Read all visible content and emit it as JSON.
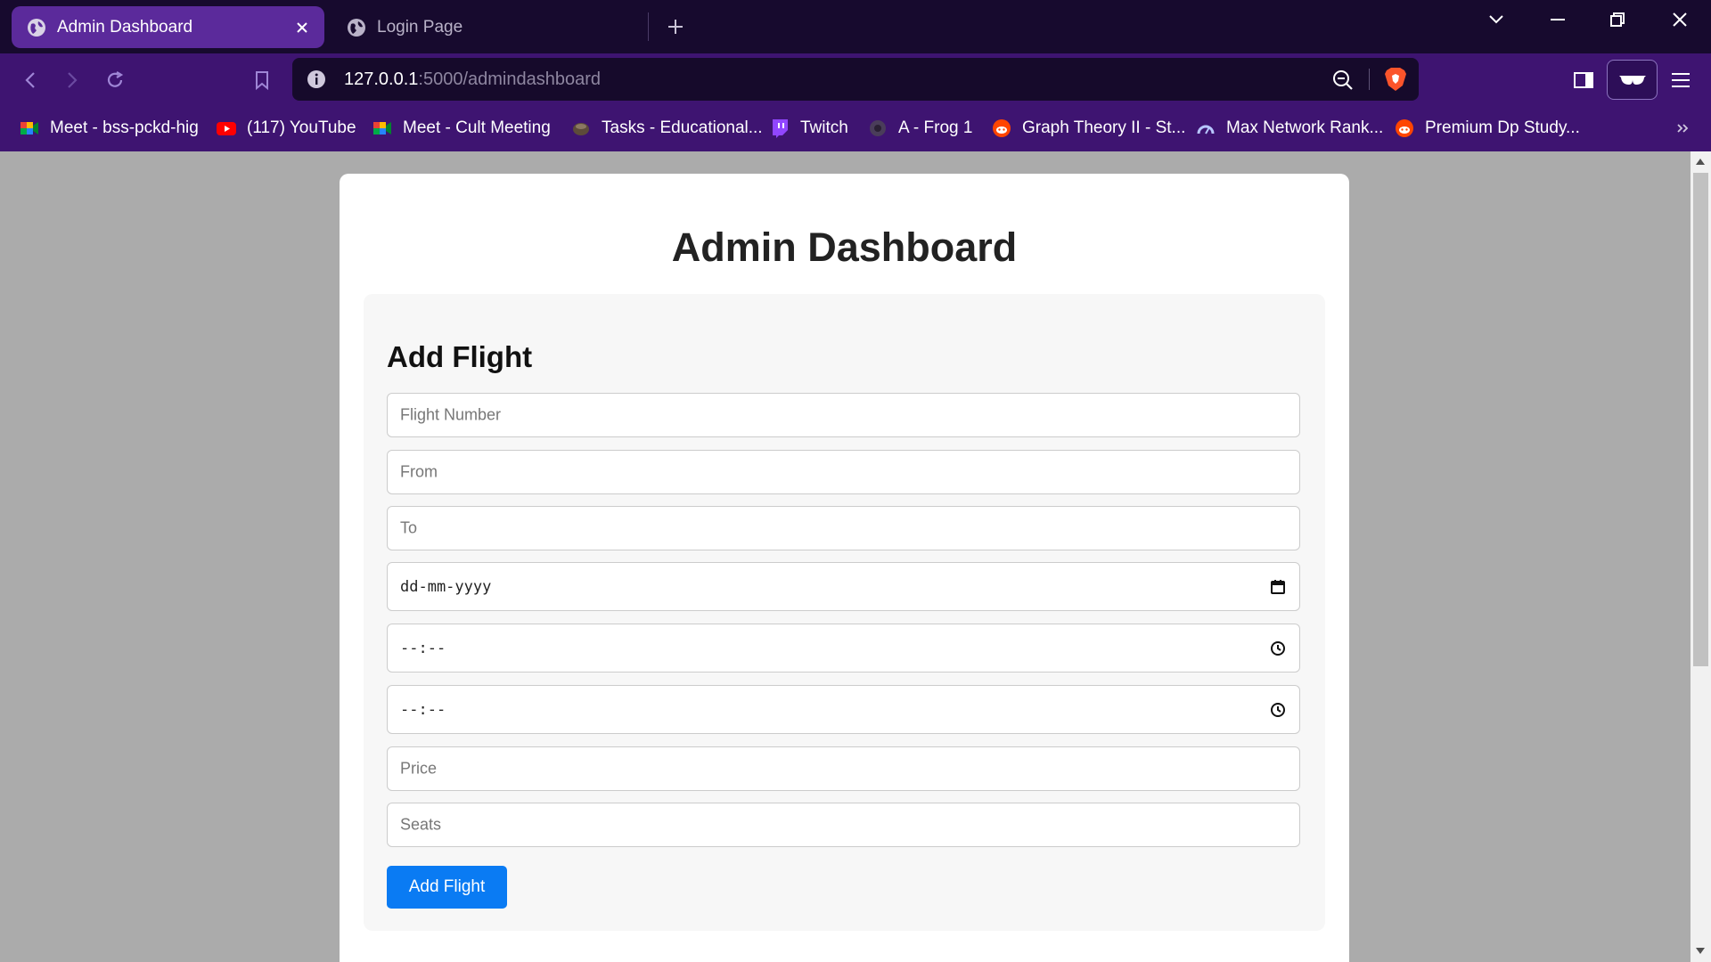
{
  "browser": {
    "tabs": [
      {
        "label": "Admin Dashboard",
        "active": true
      },
      {
        "label": "Login Page",
        "active": false
      }
    ],
    "url": {
      "host": "127.0.0.1",
      "rest": ":5000/admindashboard"
    },
    "bookmarks": [
      {
        "label": "Meet - bss-pckd-hig",
        "icon": "google-meet-icon"
      },
      {
        "label": "(117) YouTube",
        "icon": "youtube-icon"
      },
      {
        "label": "Meet - Cult Meeting",
        "icon": "google-meet-icon"
      },
      {
        "label": "Tasks - Educational...",
        "icon": "codechef-icon"
      },
      {
        "label": "Twitch",
        "icon": "twitch-icon"
      },
      {
        "label": "A - Frog 1",
        "icon": "atcoder-icon"
      },
      {
        "label": "Graph Theory II - St...",
        "icon": "reddit-icon"
      },
      {
        "label": "Max Network Rank...",
        "icon": "leetcode-icon"
      },
      {
        "label": "Premium Dp Study...",
        "icon": "reddit-icon"
      }
    ],
    "colors": {
      "accent": "#5b2a9b",
      "toolbar": "#3e1471",
      "tabbar": "#170a2e"
    }
  },
  "page": {
    "title": "Admin Dashboard",
    "form": {
      "heading": "Add Flight",
      "fields": {
        "flight_number": {
          "placeholder": "Flight Number"
        },
        "from": {
          "placeholder": "From"
        },
        "to": {
          "placeholder": "To"
        },
        "date": {
          "value": "dd-mm-yyyy"
        },
        "departure_time": {
          "value": "--:--"
        },
        "arrival_time": {
          "value": "--:--"
        },
        "price": {
          "placeholder": "Price"
        },
        "seats": {
          "placeholder": "Seats"
        }
      },
      "submit_label": "Add Flight"
    },
    "colors": {
      "button": "#0a7bf3"
    }
  }
}
